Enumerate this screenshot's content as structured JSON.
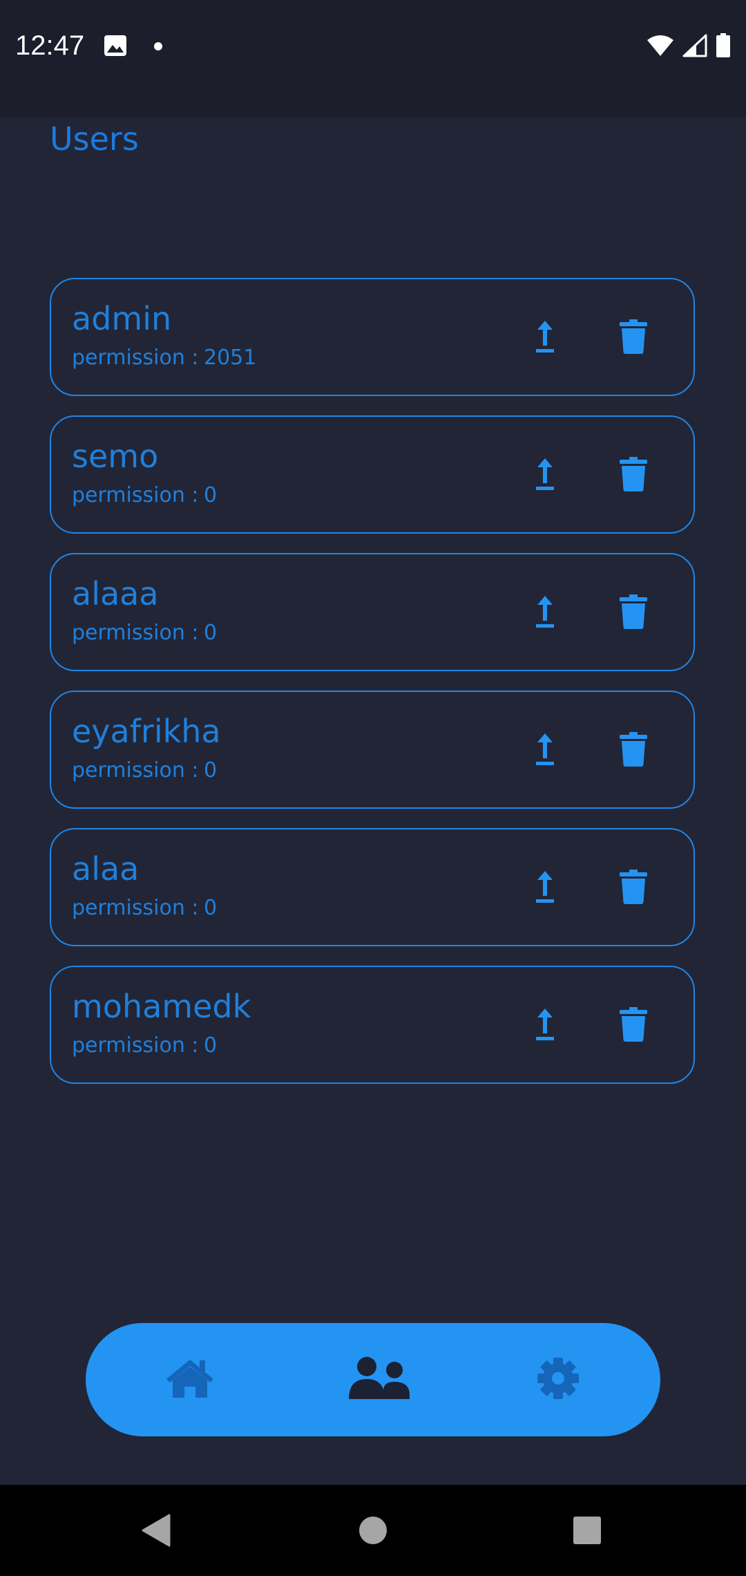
{
  "status_bar": {
    "time": "12:47",
    "left_icons": [
      "image-icon",
      "notification-dot-icon"
    ],
    "right_icons": [
      "wifi-icon",
      "signal-icon",
      "battery-icon"
    ]
  },
  "page": {
    "title": "Users"
  },
  "users": [
    {
      "name": "admin",
      "permission_label": "permission :",
      "permission": "2051"
    },
    {
      "name": "semo",
      "permission_label": "permission :",
      "permission": "0"
    },
    {
      "name": "alaaa",
      "permission_label": "permission :",
      "permission": "0"
    },
    {
      "name": "eyafrikha",
      "permission_label": "permission :",
      "permission": "0"
    },
    {
      "name": "alaa",
      "permission_label": "permission :",
      "permission": "0"
    },
    {
      "name": "mohamedk",
      "permission_label": "permission :",
      "permission": "0"
    }
  ],
  "row_actions": [
    "upload-icon",
    "trash-icon"
  ],
  "bottom_nav": {
    "items": [
      {
        "icon": "home-icon",
        "active": false
      },
      {
        "icon": "users-icon",
        "active": true
      },
      {
        "icon": "gear-icon",
        "active": false
      }
    ]
  },
  "system_nav": [
    "back-icon",
    "home-circle-icon",
    "recents-icon"
  ],
  "colors": {
    "background": "#222536",
    "status_bar": "#1c1e2c",
    "accent": "#2494f3",
    "text_accent": "#1f80dc",
    "nav_icon_inactive": "#1565b8",
    "nav_icon_active": "#1c2133"
  }
}
